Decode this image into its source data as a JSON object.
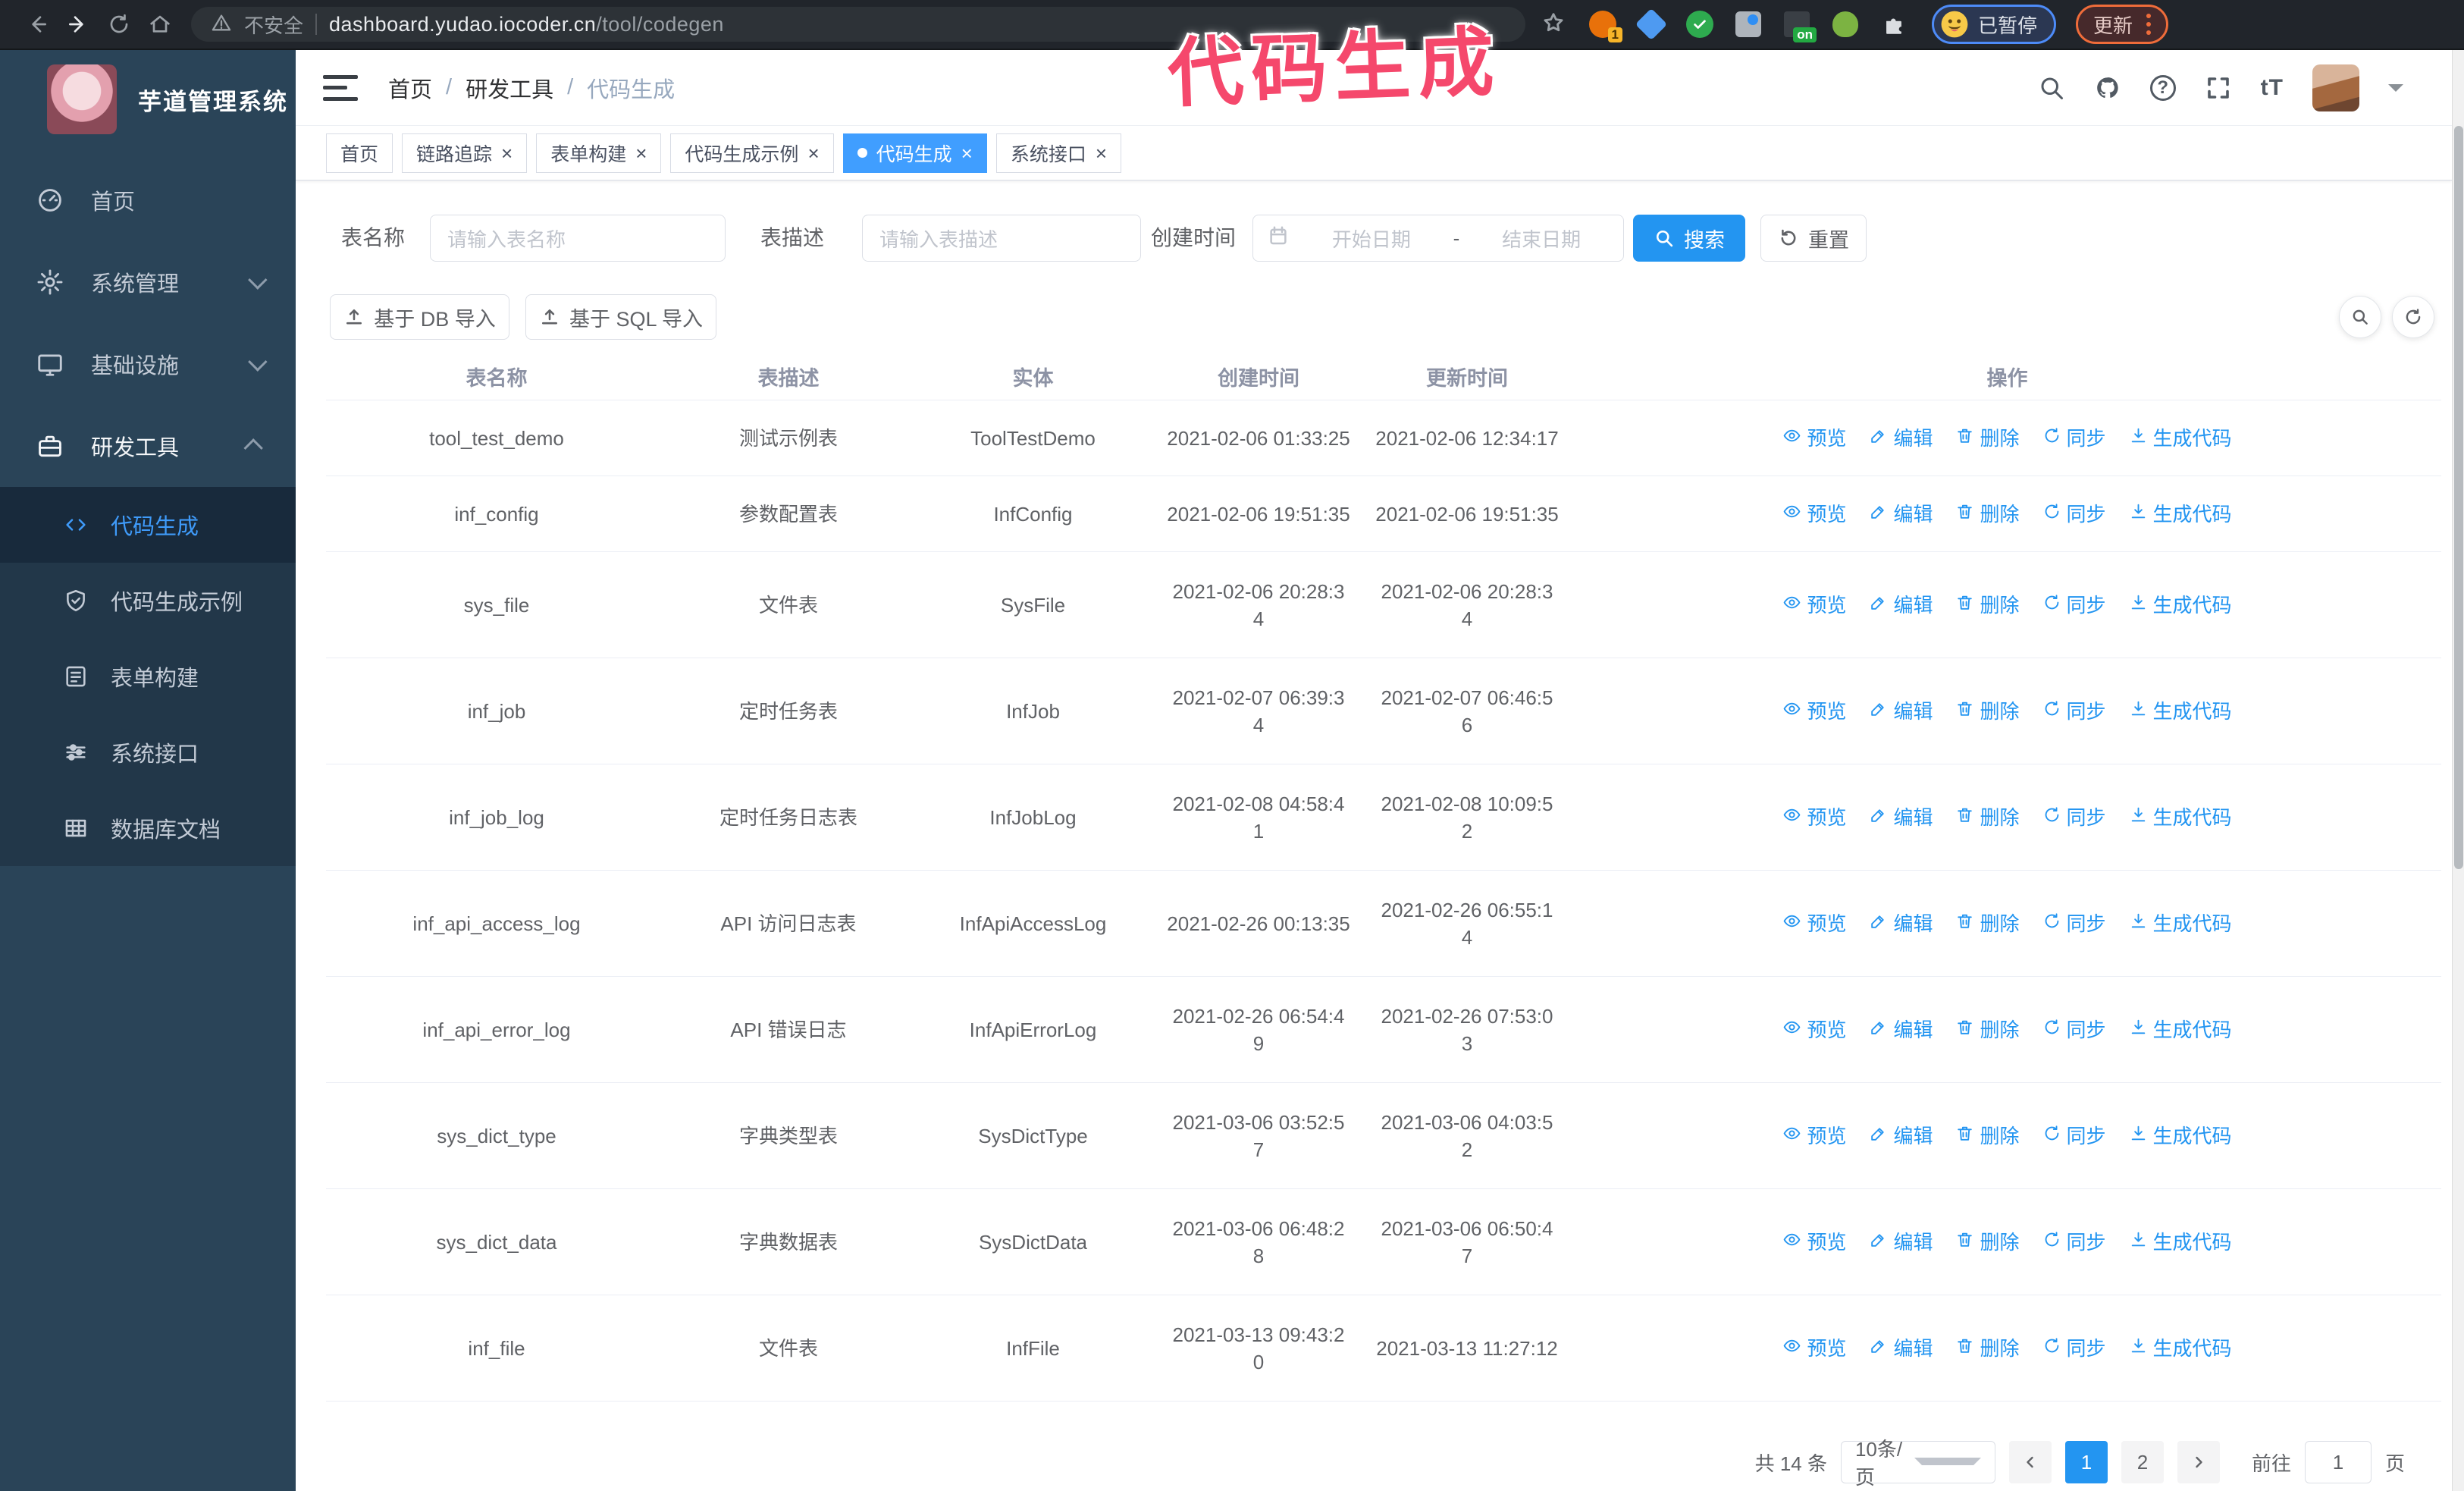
{
  "browser": {
    "security_label": "不安全",
    "url_domain": "dashboard.yudao.iocoder.cn",
    "url_path": "/tool/codegen",
    "extension_badge": "1",
    "extension_on_badge": "on",
    "paused_badge": "已暂停",
    "update_label": "更新"
  },
  "annotation": {
    "text": "代码生成",
    "color": "#f5486c"
  },
  "sidebar": {
    "logo_title": "芋道管理系统",
    "items": [
      {
        "label": "首页",
        "icon": "dashboard-icon"
      },
      {
        "label": "系统管理",
        "icon": "gear-icon",
        "chevron": "down"
      },
      {
        "label": "基础设施",
        "icon": "monitor-icon",
        "chevron": "down"
      },
      {
        "label": "研发工具",
        "icon": "toolbox-icon",
        "chevron": "up",
        "expanded": true
      }
    ],
    "subitems": [
      {
        "label": "代码生成",
        "icon": "code-icon",
        "active": true
      },
      {
        "label": "代码生成示例",
        "icon": "shield-check-icon"
      },
      {
        "label": "表单构建",
        "icon": "form-icon"
      },
      {
        "label": "系统接口",
        "icon": "sliders-icon"
      },
      {
        "label": "数据库文档",
        "icon": "table-grid-icon"
      }
    ]
  },
  "navbar": {
    "breadcrumb": [
      "首页",
      "研发工具",
      "代码生成"
    ]
  },
  "tabs": [
    {
      "label": "首页",
      "closable": false,
      "active": false
    },
    {
      "label": "链路追踪",
      "closable": true,
      "active": false
    },
    {
      "label": "表单构建",
      "closable": true,
      "active": false
    },
    {
      "label": "代码生成示例",
      "closable": true,
      "active": false
    },
    {
      "label": "代码生成",
      "closable": true,
      "active": true
    },
    {
      "label": "系统接口",
      "closable": true,
      "active": false
    }
  ],
  "search": {
    "name_label": "表名称",
    "name_placeholder": "请输入表名称",
    "desc_label": "表描述",
    "desc_placeholder": "请输入表描述",
    "time_label": "创建时间",
    "start_placeholder": "开始日期",
    "range_separator": "-",
    "end_placeholder": "结束日期",
    "search_button": "搜索",
    "reset_button": "重置"
  },
  "toolbar": {
    "import_db": "基于 DB 导入",
    "import_sql": "基于 SQL 导入"
  },
  "table": {
    "columns": [
      "表名称",
      "表描述",
      "实体",
      "创建时间",
      "更新时间",
      "操作"
    ],
    "actions": [
      {
        "label": "预览",
        "icon": "eye-icon"
      },
      {
        "label": "编辑",
        "icon": "edit-icon"
      },
      {
        "label": "删除",
        "icon": "delete-icon"
      },
      {
        "label": "同步",
        "icon": "sync-icon"
      },
      {
        "label": "生成代码",
        "icon": "download-icon"
      }
    ],
    "rows": [
      {
        "name": "tool_test_demo",
        "desc": "测试示例表",
        "entity": "ToolTestDemo",
        "created": "2021-02-06 01:33:25",
        "updated": "2021-02-06 12:34:17",
        "created_wrap": false,
        "updated_wrap": false
      },
      {
        "name": "inf_config",
        "desc": "参数配置表",
        "entity": "InfConfig",
        "created": "2021-02-06 19:51:35",
        "updated": "2021-02-06 19:51:35",
        "created_wrap": false,
        "updated_wrap": false
      },
      {
        "name": "sys_file",
        "desc": "文件表",
        "entity": "SysFile",
        "created": "2021-02-06 20:28:34",
        "updated": "2021-02-06 20:28:34",
        "created_wrap": true,
        "updated_wrap": true
      },
      {
        "name": "inf_job",
        "desc": "定时任务表",
        "entity": "InfJob",
        "created": "2021-02-07 06:39:34",
        "updated": "2021-02-07 06:46:56",
        "created_wrap": true,
        "updated_wrap": true
      },
      {
        "name": "inf_job_log",
        "desc": "定时任务日志表",
        "entity": "InfJobLog",
        "created": "2021-02-08 04:58:41",
        "updated": "2021-02-08 10:09:52",
        "created_wrap": true,
        "updated_wrap": true
      },
      {
        "name": "inf_api_access_log",
        "desc": "API 访问日志表",
        "entity": "InfApiAccessLog",
        "created": "2021-02-26 00:13:35",
        "updated": "2021-02-26 06:55:14",
        "created_wrap": false,
        "updated_wrap": true
      },
      {
        "name": "inf_api_error_log",
        "desc": "API 错误日志",
        "entity": "InfApiErrorLog",
        "created": "2021-02-26 06:54:49",
        "updated": "2021-02-26 07:53:03",
        "created_wrap": true,
        "updated_wrap": true
      },
      {
        "name": "sys_dict_type",
        "desc": "字典类型表",
        "entity": "SysDictType",
        "created": "2021-03-06 03:52:57",
        "updated": "2021-03-06 04:03:52",
        "created_wrap": true,
        "updated_wrap": true
      },
      {
        "name": "sys_dict_data",
        "desc": "字典数据表",
        "entity": "SysDictData",
        "created": "2021-03-06 06:48:28",
        "updated": "2021-03-06 06:50:47",
        "created_wrap": true,
        "updated_wrap": true
      },
      {
        "name": "inf_file",
        "desc": "文件表",
        "entity": "InfFile",
        "created": "2021-03-13 09:43:20",
        "updated": "2021-03-13 11:27:12",
        "created_wrap": true,
        "updated_wrap": false
      }
    ]
  },
  "pagination": {
    "total_label": "共 14 条",
    "page_size": "10条/页",
    "pages": [
      "1",
      "2"
    ],
    "active_page": "1",
    "goto_label": "前往",
    "goto_value": "1",
    "page_unit": "页"
  },
  "colors": {
    "primary": "#2395f1",
    "sidebar_bg": "#2a4458",
    "submenu_bg": "#223749",
    "active_menu_text": "#3f9bfa",
    "annotation_pink": "#f5486c",
    "update_border": "#ef6c3a",
    "paused_border": "#4d8bf8"
  }
}
